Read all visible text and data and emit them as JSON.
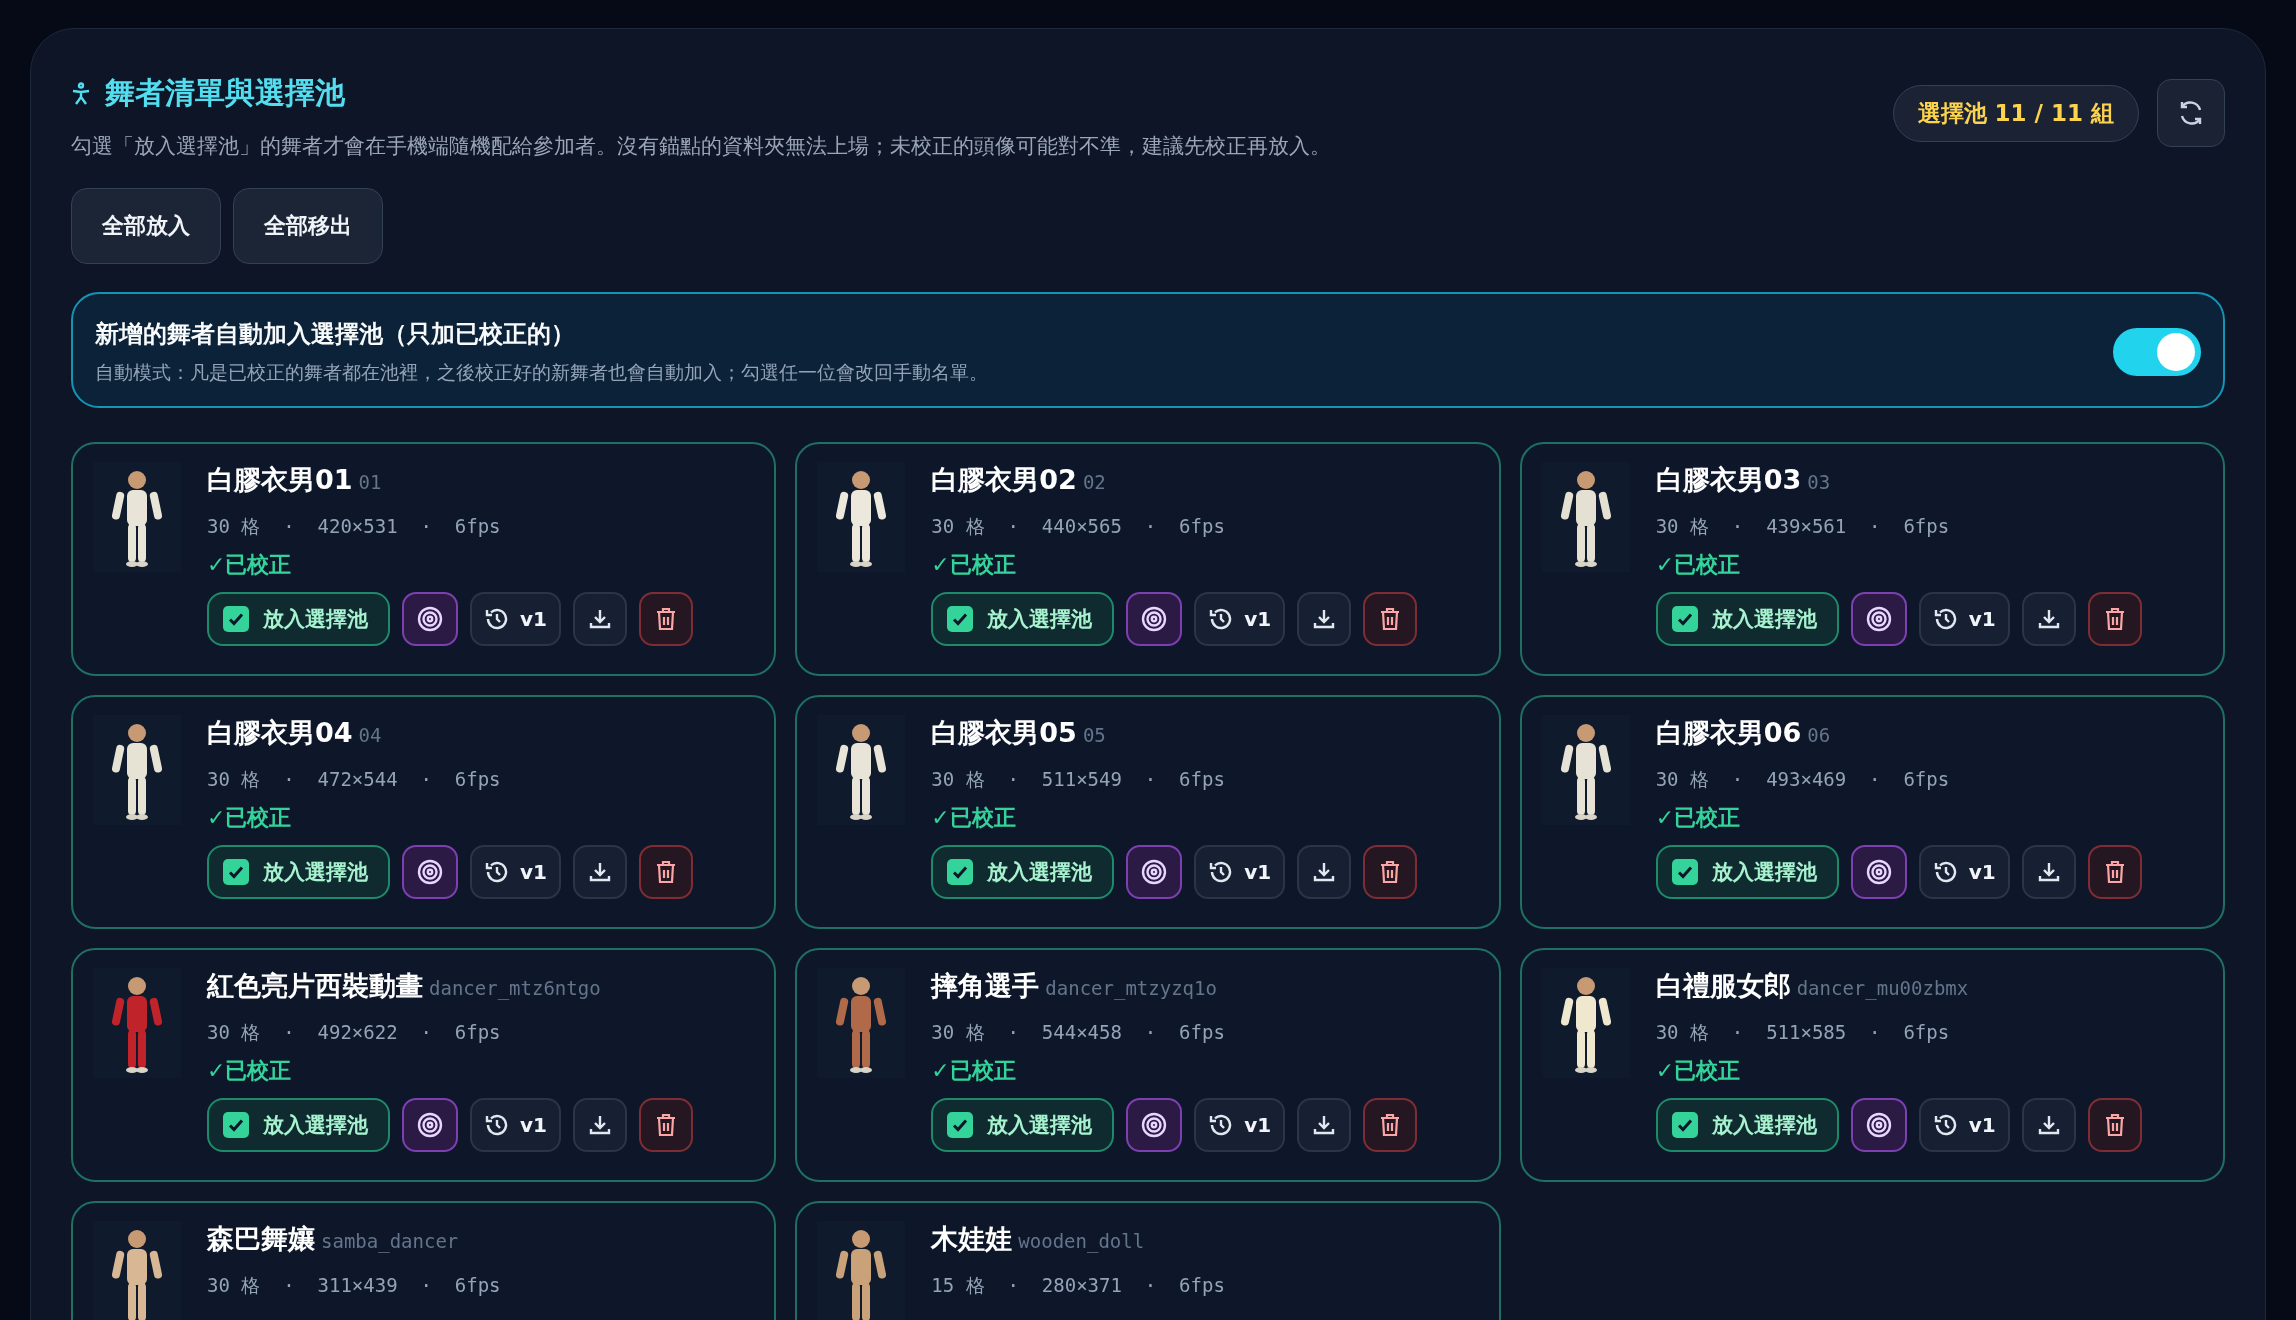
{
  "header": {
    "title": "舞者清單與選擇池",
    "description": "勾選「放入選擇池」的舞者才會在手機端隨機配給參加者。沒有錨點的資料夾無法上場；未校正的頭像可能對不準，建議先校正再放入。",
    "pool_badge": "選擇池 11 / 11 組"
  },
  "bulk_buttons": [
    "全部放入",
    "全部移出"
  ],
  "auto_panel": {
    "title": "新增的舞者自動加入選擇池（只加已校正的）",
    "description": "自動模式：凡是已校正的舞者都在池裡，之後校正好的新舞者也會自動加入；勾選任一位會改回手動名單。",
    "on": true
  },
  "dancers": [
    {
      "name": "白膠衣男01",
      "id": "01",
      "meta": "30 格 · 420×531 · 6fps",
      "status": "✓已校正",
      "pool_label": "放入選擇池",
      "in_pool": true,
      "version": "v1"
    },
    {
      "name": "白膠衣男02",
      "id": "02",
      "meta": "30 格 · 440×565 · 6fps",
      "status": "✓已校正",
      "pool_label": "放入選擇池",
      "in_pool": true,
      "version": "v1"
    },
    {
      "name": "白膠衣男03",
      "id": "03",
      "meta": "30 格 · 439×561 · 6fps",
      "status": "✓已校正",
      "pool_label": "放入選擇池",
      "in_pool": true,
      "version": "v1"
    },
    {
      "name": "白膠衣男04",
      "id": "04",
      "meta": "30 格 · 472×544 · 6fps",
      "status": "✓已校正",
      "pool_label": "放入選擇池",
      "in_pool": true,
      "version": "v1"
    },
    {
      "name": "白膠衣男05",
      "id": "05",
      "meta": "30 格 · 511×549 · 6fps",
      "status": "✓已校正",
      "pool_label": "放入選擇池",
      "in_pool": true,
      "version": "v1"
    },
    {
      "name": "白膠衣男06",
      "id": "06",
      "meta": "30 格 · 493×469 · 6fps",
      "status": "✓已校正",
      "pool_label": "放入選擇池",
      "in_pool": true,
      "version": "v1"
    },
    {
      "name": "紅色亮片西裝動畫",
      "id": "dancer_mtz6ntgo",
      "meta": "30 格 · 492×622 · 6fps",
      "status": "✓已校正",
      "pool_label": "放入選擇池",
      "in_pool": true,
      "version": "v1"
    },
    {
      "name": "摔角選手",
      "id": "dancer_mtzyzq1o",
      "meta": "30 格 · 544×458 · 6fps",
      "status": "✓已校正",
      "pool_label": "放入選擇池",
      "in_pool": true,
      "version": "v1"
    },
    {
      "name": "白禮服女郎",
      "id": "dancer_mu00zbmx",
      "meta": "30 格 · 511×585 · 6fps",
      "status": "✓已校正",
      "pool_label": "放入選擇池",
      "in_pool": true,
      "version": "v1"
    },
    {
      "name": "森巴舞孃",
      "id": "samba_dancer",
      "meta": "30 格 · 311×439 · 6fps"
    },
    {
      "name": "木娃娃",
      "id": "wooden_doll",
      "meta": "15 格 · 280×371 · 6fps"
    }
  ]
}
